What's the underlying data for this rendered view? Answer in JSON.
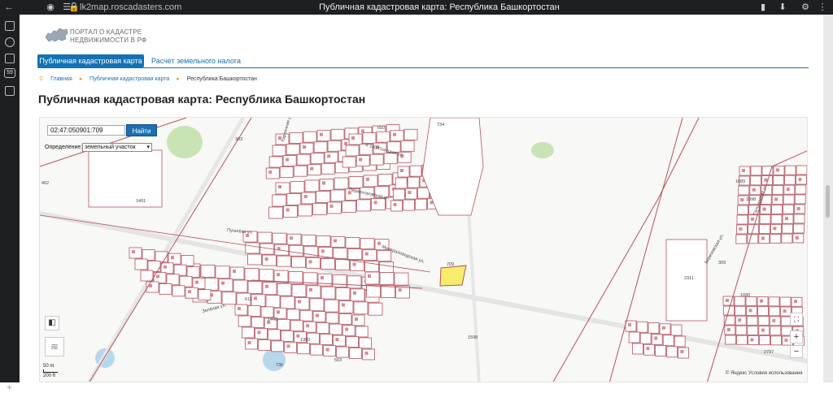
{
  "browser": {
    "url": "lk2map.roscadasters.com",
    "page_title": "Публичная кадастровая карта: Республика Башкортостан",
    "rail_badge": "59"
  },
  "header": {
    "logo_line1": "ПОРТАЛ О КАДАСТРЕ",
    "logo_line2": "НЕДВИЖИМОСТИ В РФ"
  },
  "nav": {
    "tab_active": "Публичная кадастровая карта",
    "tab_link": "Расчет земельного налога"
  },
  "breadcrumb": [
    "Главная",
    "Публичная кадастровая карта",
    "Республика Башкортостан"
  ],
  "page_heading": "Публичная кадастровая карта: Республика Башкортостан",
  "map": {
    "search_value": "02:47:050901:709",
    "search_button": "Найти",
    "definition_label": "Определение:",
    "definition_value": "земельный участок",
    "scale_top": "50 m",
    "scale_bottom": "200 ft",
    "attribution": "© Яндекс  Условия использования",
    "highlight_color": "#f7ec6c",
    "parcel_border_color": "#b5525c",
    "street_labels": [
      "Кирпичная ул.",
      "К-140/Платская ул.",
      "Пермогоровская ул.",
      "Пугачёва ул.",
      "Минераловодская ул.",
      "Зелёная ул.",
      "Гальгинская ул.",
      "Березовская ул."
    ],
    "parcel_numbers": [
      "650",
      "734",
      "303",
      "402",
      "1401",
      "709",
      "1598",
      "2311",
      "1446",
      "1303",
      "736",
      "503",
      "611",
      "1098",
      "1089",
      "1090",
      "309",
      "2797"
    ]
  }
}
